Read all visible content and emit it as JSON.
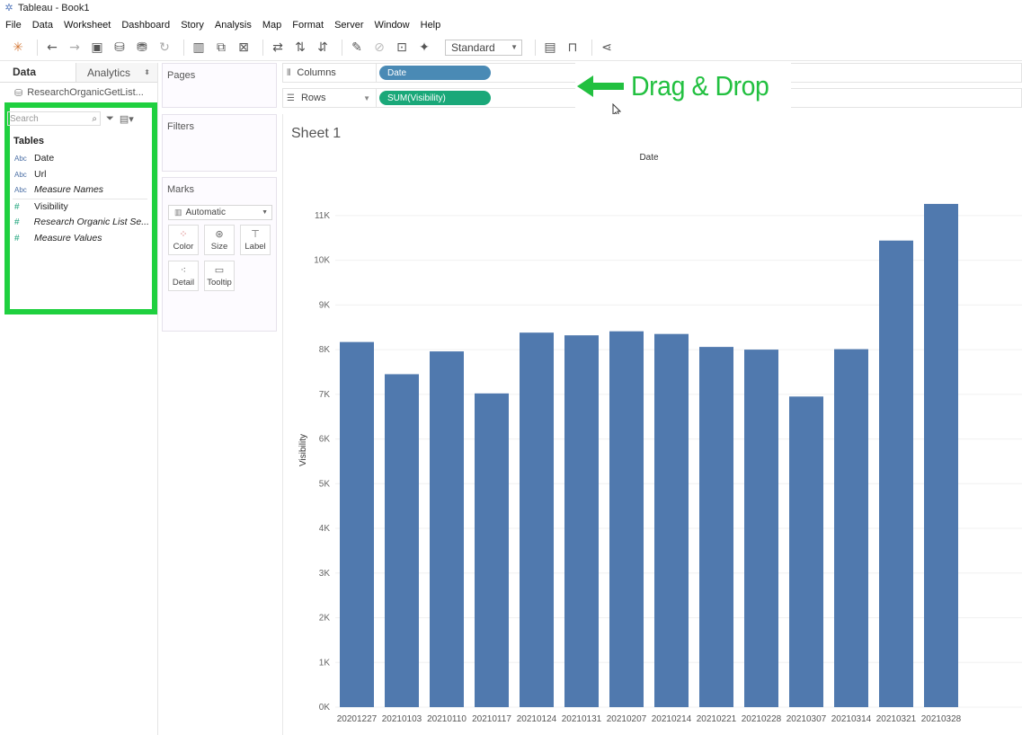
{
  "window": {
    "title": "Tableau - Book1"
  },
  "menu": [
    "File",
    "Data",
    "Worksheet",
    "Dashboard",
    "Story",
    "Analysis",
    "Map",
    "Format",
    "Server",
    "Window",
    "Help"
  ],
  "toolbar": {
    "icons": [
      "tableau-logo-icon",
      "back-icon",
      "forward-icon",
      "save-icon",
      "new-datasource-icon",
      "pause-updates-icon",
      "refresh-icon",
      "new-worksheet-icon",
      "duplicate-sheet-icon",
      "clear-sheet-icon",
      "swap-icon",
      "sort-ascending-icon",
      "sort-descending-icon",
      "highlight-icon",
      "group-icon",
      "show-labels-icon",
      "pin-icon",
      "show-me-icon",
      "presentation-icon",
      "share-icon"
    ],
    "fit_select": "Standard"
  },
  "data_pane": {
    "tabs": {
      "data": "Data",
      "analytics": "Analytics"
    },
    "datasource": "ResearchOrganicGetList...",
    "search_placeholder": "Search",
    "tables_heading": "Tables",
    "fields": [
      {
        "type": "Abc",
        "name": "Date",
        "italic": false
      },
      {
        "type": "Abc",
        "name": "Url",
        "italic": false
      },
      {
        "type": "Abc",
        "name": "Measure Names",
        "italic": true
      },
      {
        "type": "#",
        "name": "Visibility",
        "italic": false
      },
      {
        "type": "#",
        "name": "Research Organic List Se...",
        "italic": true
      },
      {
        "type": "#",
        "name": "Measure Values",
        "italic": true
      }
    ]
  },
  "cards": {
    "pages": "Pages",
    "filters": "Filters",
    "marks": {
      "title": "Marks",
      "type_select": "Automatic",
      "buttons": {
        "color": "Color",
        "size": "Size",
        "label": "Label",
        "detail": "Detail",
        "tooltip": "Tooltip"
      }
    }
  },
  "shelves": {
    "columns": {
      "label": "Columns",
      "pill": "Date",
      "pill_color": "#4a8ab5"
    },
    "rows": {
      "label": "Rows",
      "pill": "SUM(Visibility)",
      "pill_color": "#1aa879"
    }
  },
  "annotation": {
    "text": "Drag & Drop",
    "color": "#22c040"
  },
  "sheet": {
    "title": "Sheet 1"
  },
  "chart_data": {
    "type": "bar",
    "title": "Date",
    "xlabel": "",
    "ylabel": "Visibility",
    "bar_color": "#5079ae",
    "ylim": [
      0,
      11500
    ],
    "yticks": [
      0,
      1000,
      2000,
      3000,
      4000,
      5000,
      6000,
      7000,
      8000,
      9000,
      10000,
      11000
    ],
    "ytick_labels": [
      "0K",
      "1K",
      "2K",
      "3K",
      "4K",
      "5K",
      "6K",
      "7K",
      "8K",
      "9K",
      "10K",
      "11K"
    ],
    "grid": "horizontal",
    "categories": [
      "20201227",
      "20210103",
      "20210110",
      "20210117",
      "20210124",
      "20210131",
      "20210207",
      "20210214",
      "20210221",
      "20210228",
      "20210307",
      "20210314",
      "20210321",
      "20210328"
    ],
    "values": [
      8170,
      7450,
      7960,
      7020,
      8380,
      8320,
      8410,
      8350,
      8060,
      8000,
      6950,
      8010,
      10440,
      11260
    ]
  }
}
